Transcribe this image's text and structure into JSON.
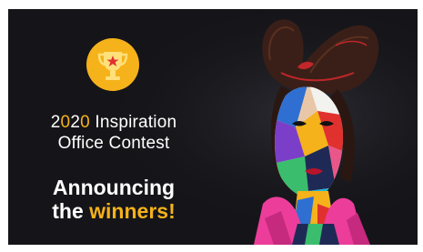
{
  "banner": {
    "title": {
      "year_a": "2",
      "year_b": "0",
      "year_c": "2",
      "year_d": "0",
      "line1_rest": " Inspiration",
      "line2": "Office Contest"
    },
    "announce": {
      "line1": "Announcing",
      "line2_prefix": "the ",
      "line2_highlight": "winners!"
    },
    "colors": {
      "background": "#151519",
      "accent": "#f5b21a",
      "text": "#ffffff"
    },
    "icons": [
      "trophy-icon",
      "star-icon"
    ]
  }
}
